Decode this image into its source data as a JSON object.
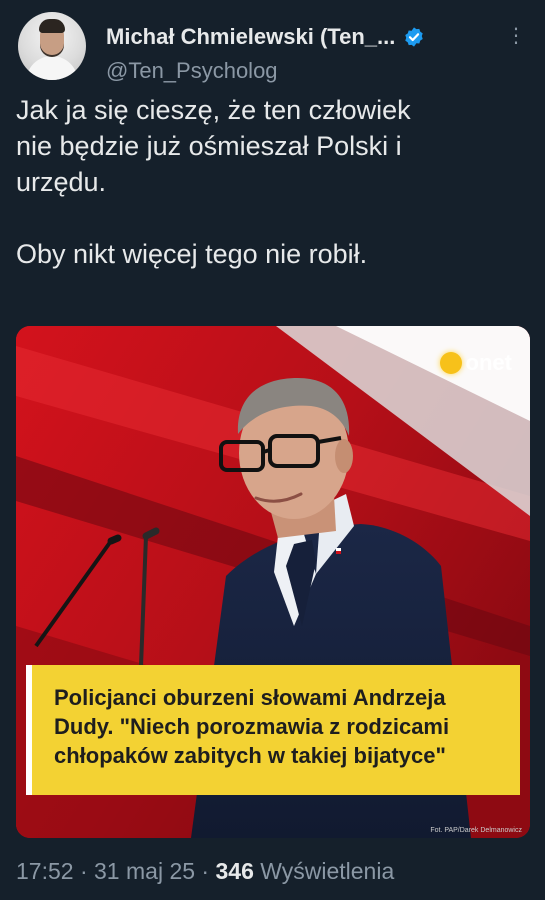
{
  "author": {
    "display_name": "Michał Chmielewski (Ten_...",
    "handle": "@Ten_Psycholog",
    "verified": true
  },
  "tweet": {
    "lines": [
      "Jak ja się cieszę, że ten człowiek",
      "nie będzie już ośmieszał Polski i",
      "urzędu.",
      "Oby nikt więcej tego nie robił."
    ]
  },
  "media": {
    "logo_text": "onet",
    "caption_lines": [
      "Policjanci oburzeni słowami Andrzeja",
      "Dudy. \"Niech porozmawia z rodzicami",
      "chłopaków zabitych w takiej bijatyce\""
    ],
    "photo_credit": "Fot. PAP/Darek Delmanowicz"
  },
  "meta": {
    "time": "17:52",
    "sep": "·",
    "date": "31 maj 25",
    "views_count": "346",
    "views_label": "Wyświetlenia"
  },
  "colors": {
    "background": "#15202b",
    "text": "#e7e9ea",
    "secondary": "#8b98a5",
    "verified": "#1d9bf0",
    "caption_bg": "#f3d233",
    "photo_red": "#c8141e"
  },
  "icons": [
    "verified-badge-icon",
    "more-options-icon"
  ]
}
